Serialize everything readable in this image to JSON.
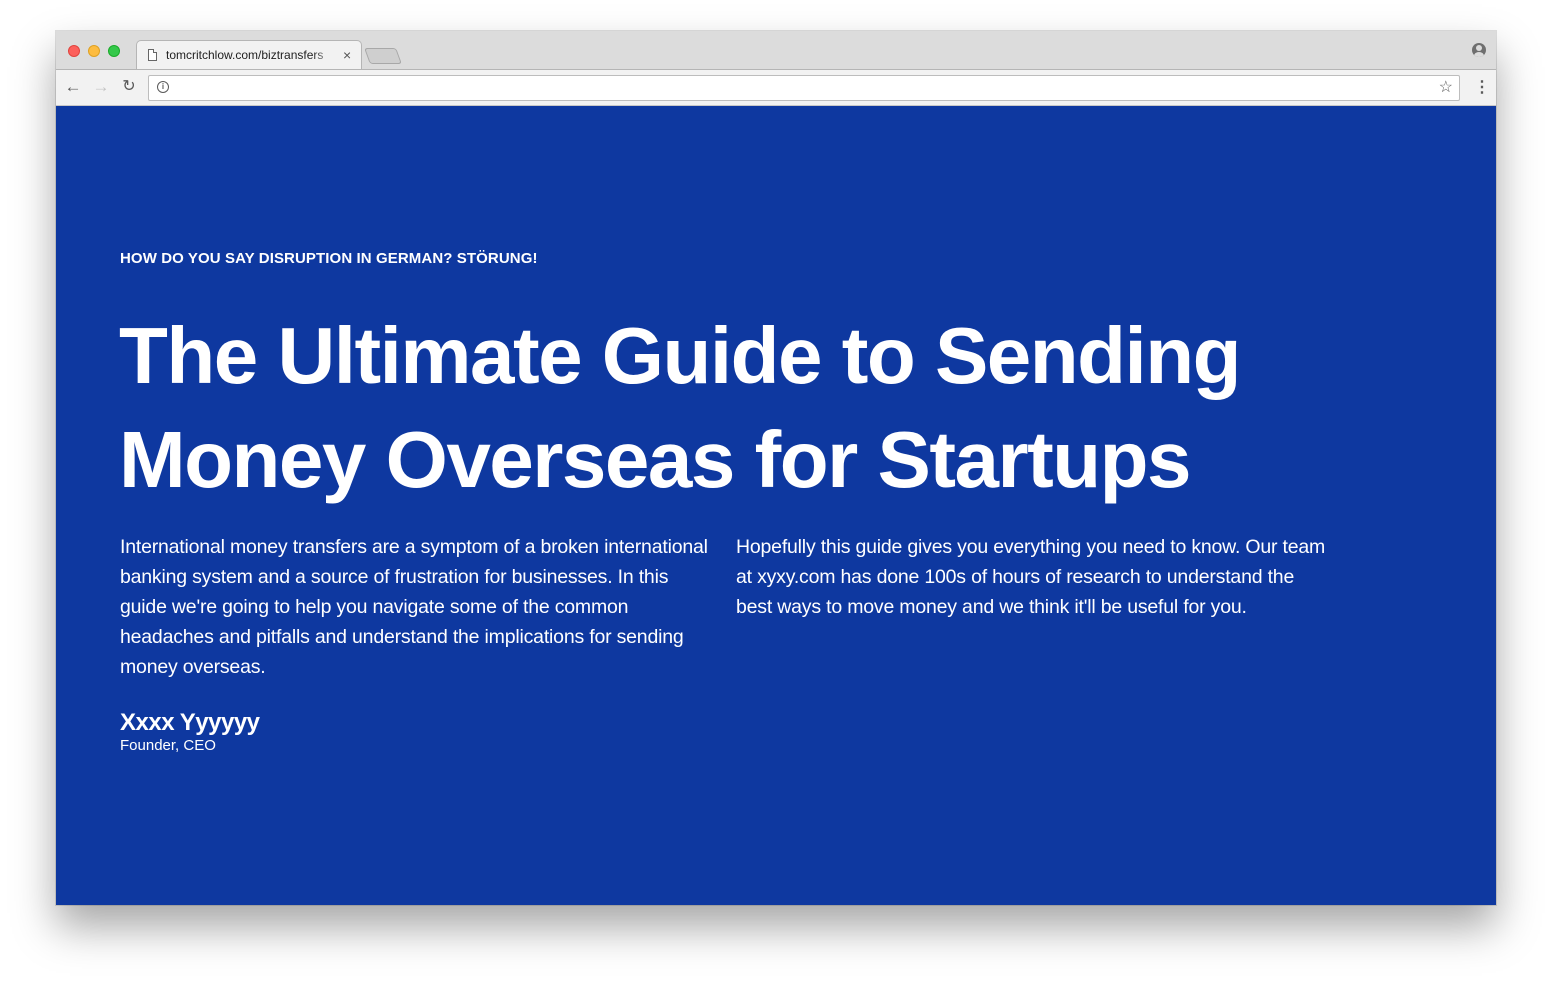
{
  "browser": {
    "tab_title": "tomcritchlow.com/biztransfers",
    "tab_close_glyph": "×",
    "url": "",
    "icons": {
      "back": "arrow-left-icon",
      "forward": "arrow-right-icon",
      "reload": "reload-icon",
      "info": "info-icon",
      "bookmark": "star-icon",
      "menu": "kebab-menu-icon",
      "profile": "profile-icon",
      "page": "page-icon"
    }
  },
  "hero": {
    "eyebrow": "HOW DO YOU SAY DISRUPTION IN GERMAN? STÖRUNG!",
    "headline_line1": "The Ultimate Guide to Sending",
    "headline_line2": "Money Overseas for Startups",
    "intro_left": "International money transfers are a symptom of a broken international banking system and a source of frustration for businesses. In this guide we're going to help you navigate some of the common headaches and pitfalls and understand the implications for sending money overseas.",
    "intro_right": "Hopefully this guide gives you everything you need to know. Our team at xyxy.com has done 100s of hours of research to understand the best ways to move money and we think it'll be useful for you.",
    "author_name": "Xxxx Yyyyyy",
    "author_role": "Founder, CEO"
  },
  "colors": {
    "page_background": "#0e38a0",
    "text": "#ffffff",
    "chrome_background": "#dcdcdc"
  }
}
